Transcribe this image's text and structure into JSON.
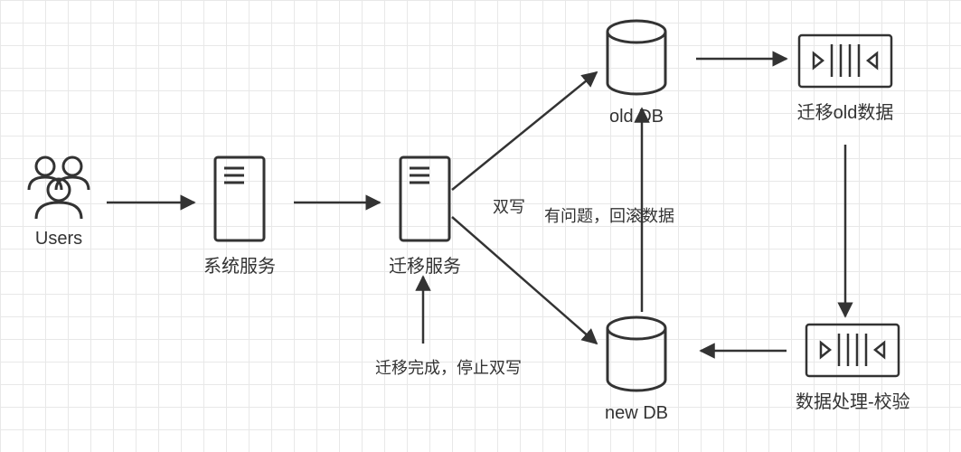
{
  "nodes": {
    "users": {
      "label": "Users"
    },
    "system_service": {
      "label": "系统服务"
    },
    "migration_service": {
      "label": "迁移服务"
    },
    "old_db": {
      "label": "old  DB"
    },
    "new_db": {
      "label": "new DB"
    },
    "migrate_old_data": {
      "label": "迁移old数据"
    },
    "data_processing": {
      "label": "数据处理-校验"
    }
  },
  "edges": {
    "dual_write": {
      "label": "双写"
    },
    "rollback": {
      "label": "有问题，回滚数据"
    },
    "stop_dual_write": {
      "label": "迁移完成，停止双写"
    }
  }
}
